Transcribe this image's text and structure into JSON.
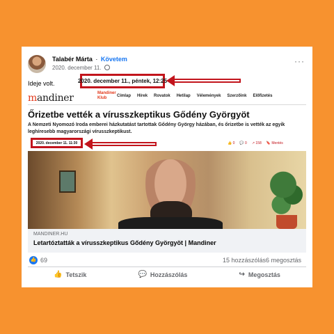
{
  "post": {
    "author": "Talabér Márta",
    "separator": "·",
    "follow": "Követem",
    "date": "2020. december 11.",
    "text": "Ideje volt.",
    "more": "···"
  },
  "annotations": {
    "big_box": "2020. december 11., péntek, 12:25",
    "small_box": "2020. december 11. 11:30"
  },
  "site": {
    "logo": "mandiner",
    "club": "Mandiner\nKlub",
    "nav": [
      "Címlap",
      "Hírek",
      "Rovatok",
      "Hetilap",
      "Vélemények",
      "Szerzőink",
      "Előfizetés"
    ]
  },
  "article": {
    "headline": "Őrizetbe vették a vírusszkeptikus Gődény Györgyöt",
    "lead": "A Nemzeti Nyomozó Iroda emberei házkutatást tartottak Gődény György házában, és őrizetbe is vették az egyik leghíresebb magyarországi vírusszkeptikust.",
    "social": [
      "0",
      "0",
      "158",
      "Mentés"
    ]
  },
  "link": {
    "domain": "MANDINER.HU",
    "title": "Letartóztatták a vírusszkeptikus Gődény Györgyöt | Mandiner"
  },
  "stats": {
    "likes": "69",
    "comments": "15 hozzászólás",
    "shares": "6 megosztás"
  },
  "actions": {
    "like": "Tetszik",
    "comment": "Hozzászólás",
    "share": "Megosztás"
  },
  "colors": {
    "background": "#f7922f",
    "annotation_red": "#c2141c",
    "fb_blue": "#1877f2"
  }
}
